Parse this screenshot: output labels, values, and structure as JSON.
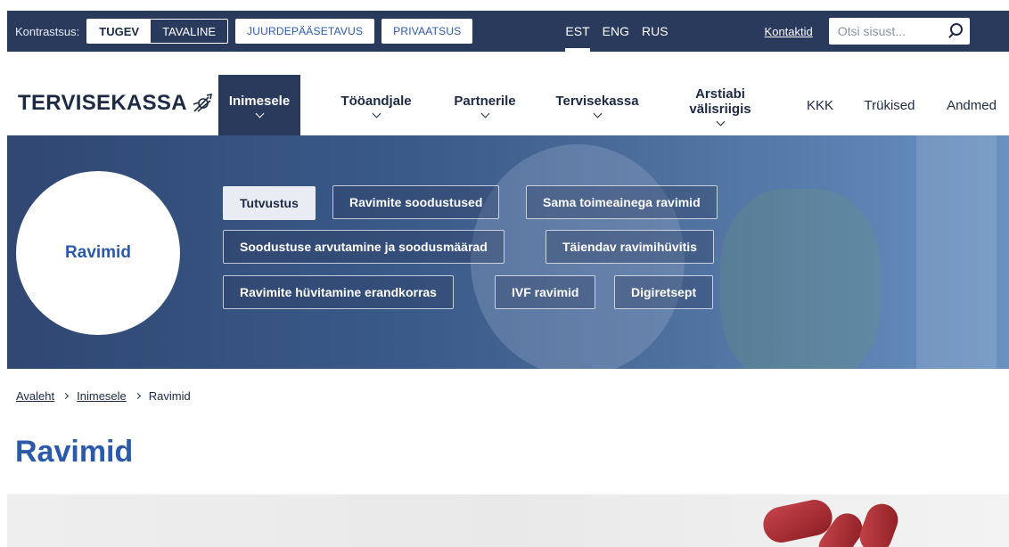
{
  "topbar": {
    "contrast_label": "Kontrastsus:",
    "contrast_strong": "TUGEV",
    "contrast_normal": "TAVALINE",
    "accessibility": "JUURDEPÄÄSETAVUS",
    "privacy": "PRIVAATSUS",
    "langs": [
      "EST",
      "ENG",
      "RUS"
    ],
    "active_lang": "EST",
    "contact": "Kontaktid",
    "search_placeholder": "Otsi sisust..."
  },
  "nav": {
    "logo": "TERVISEKASSA",
    "items": [
      {
        "label": "Inimesele"
      },
      {
        "label": "Tööandjale"
      },
      {
        "label": "Partnerile"
      },
      {
        "label": "Tervisekassa"
      },
      {
        "label_line1": "Arstiabi",
        "label_line2": "välisriigis"
      },
      {
        "label": "KKK"
      },
      {
        "label": "Trükised"
      },
      {
        "label": "Andmed"
      }
    ]
  },
  "hero": {
    "circle_title": "Ravimid",
    "chips": [
      "Tutvustus",
      "Ravimite soodustused",
      "Sama toimeainega ravimid",
      "Soodustuse arvutamine ja soodusmäärad",
      "Täiendav ravimihüvitis",
      "Ravimite hüvitamine erandkorras",
      "IVF ravimid",
      "Digiretsept"
    ]
  },
  "breadcrumb": [
    "Avaleht",
    "Inimesele",
    "Ravimid"
  ],
  "page_title": "Ravimid",
  "colors": {
    "navy": "#2a3a5c",
    "brand_blue": "#2b5aa8"
  }
}
